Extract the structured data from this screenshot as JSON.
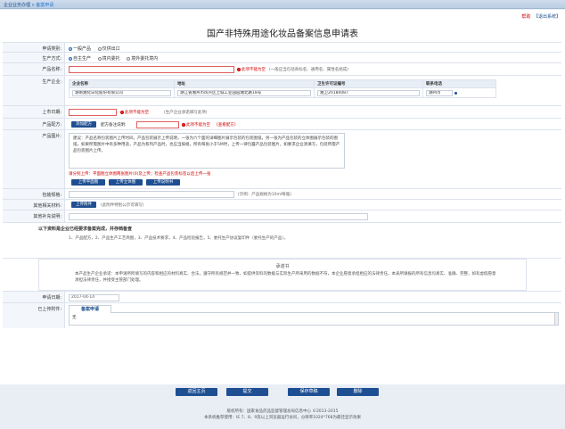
{
  "breadcrumb": {
    "prefix": "企业业务办理 » ",
    "current": "备案申请"
  },
  "top_links": {
    "help": "帮助",
    "back": "【退出系统】"
  },
  "page_title": "国产非特殊用途化妆品备案信息申请表",
  "fields": {
    "apply_type": {
      "label": "申请类别:",
      "options": [
        "一般产品",
        "仅供出口"
      ],
      "selected": 0
    },
    "production": {
      "label": "生产方式:",
      "options": [
        "自主生产",
        "境内委托",
        "境外委托境内"
      ],
      "selected": 0
    },
    "product_name": {
      "label": "产品名称:",
      "value": "",
      "required_msg": "此项不能为空",
      "hint": "(一般应当包括商标名、通用名、属性名组成)"
    },
    "manufacturer": {
      "label": "生产企业:",
      "columns": [
        "企业名称",
        "地址",
        "卫生许可证编号",
        "联系电话"
      ],
      "rows": [
        [
          "湖南湘化日化股份有限公司",
          "湖江省湘州市风兴区上城工业园园湘北路18号",
          "湘卫20180087",
          "湖州市"
        ]
      ]
    },
    "launch_date": {
      "label": "上市日期:",
      "value": "",
      "required_msg": "此项不能为空",
      "hint": "(生产企业承诺填写此项)"
    },
    "formula": {
      "label": "产品配方:",
      "button": "添加配方",
      "name_label": "配方备注说明:",
      "required_msg": "此项不能为空",
      "view_link": "[查看配方]"
    },
    "packaging": {
      "label": "产品图片:",
      "description": "建议：产品名称包装图片上传时间，产品包装展示上传说明，一张为六个面的详细图片展示包装的包装图纸，另一张为产品包装的立体图展示包装的图纸，如果所需图片中有多种用途，产品为系列产品时，也应当按规，所有每张小于5M时，上传一律包露产品包装图片，如要求企业须填写，包装所需产品包装图片上传。",
      "red_tip": "请分别上传：平面图立体图两张图片(0)及上传；检查产品包装标签以后上传一张",
      "buttons": [
        "上传平面图",
        "上传立体图",
        "上传说明书"
      ]
    },
    "spec": {
      "label": "包装规格:",
      "value": "",
      "hint": "(示例：产品规格为10ml每瓶)"
    },
    "other_material": {
      "label": "其他相关材料:",
      "button": "上传附件",
      "hint": "(此附件特别公示可填写)"
    },
    "other_note": {
      "label": "其他补充说明:",
      "value": ""
    },
    "required_docs": {
      "heading": "以下资料是企业已经要求备案完成，并存档备查",
      "items": "1、产品配方，2、产品生产工艺简图，3、产品技术要求，4、产品检验报告，5、委托生产协议复印件（委托生产的产品）。"
    },
    "promise": {
      "title": "承诺书",
      "body": "本产品生产企业承诺：本申请所所填写的内容和相应的材料真实、合法，遵守所有规范并一致，如提供资料的数据与实际生产所采用的数据不符，本企业愿意承担相应的法律责任。本表所填报的所有信息均真实、准确、完整，如有虚假愿意承担法律责任，并接受主管部门处理。"
    },
    "apply_date": {
      "label": "申请日期:",
      "value": "2017-04-14"
    },
    "uploaded": {
      "label": "已上传附件:",
      "tab": "备案申请",
      "content": "无"
    }
  },
  "bottom_buttons": [
    "返回主页",
    "提交",
    "保存草稿",
    "删除"
  ],
  "footer": {
    "line1": "版权所有：国家食品药品监督管理总局信息中心 ©2013-2015",
    "line2": "本系统推荐使用：IE 7、8、9及以上浏览器运行访问，分辨率1024*768为最佳显示效果"
  }
}
